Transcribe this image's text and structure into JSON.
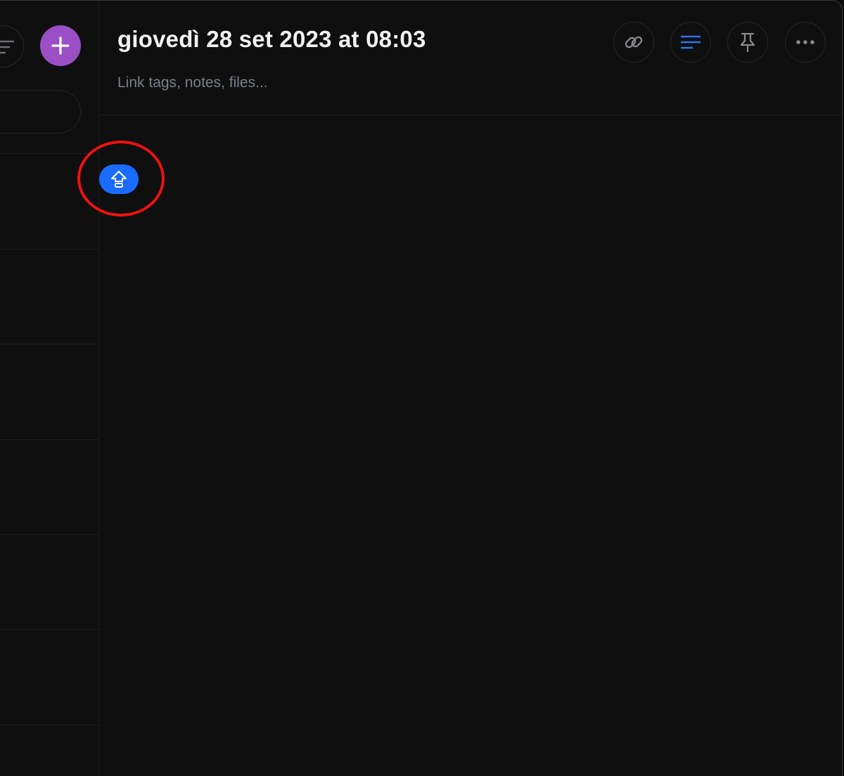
{
  "note": {
    "title": "giovedì 28 set 2023 at 08:03",
    "links_placeholder": "Link tags, notes, files..."
  },
  "sidebar": {
    "new_button_icon": "plus-icon",
    "sort_button_icon": "sort-icon"
  },
  "toolbar": {
    "buttons": [
      {
        "icon": "link-icon"
      },
      {
        "icon": "text-format-icon"
      },
      {
        "icon": "pin-icon"
      },
      {
        "icon": "more-icon"
      }
    ]
  },
  "floating_action": {
    "icon": "upload-arrow-icon",
    "highlighted": true
  },
  "colors": {
    "background": "#0f0f10",
    "accent_purple": "#9b4fc4",
    "accent_blue": "#1a6bff",
    "highlight_red": "#ee1111",
    "title_text": "#f2f2f2",
    "muted_text": "#7c7f88"
  }
}
